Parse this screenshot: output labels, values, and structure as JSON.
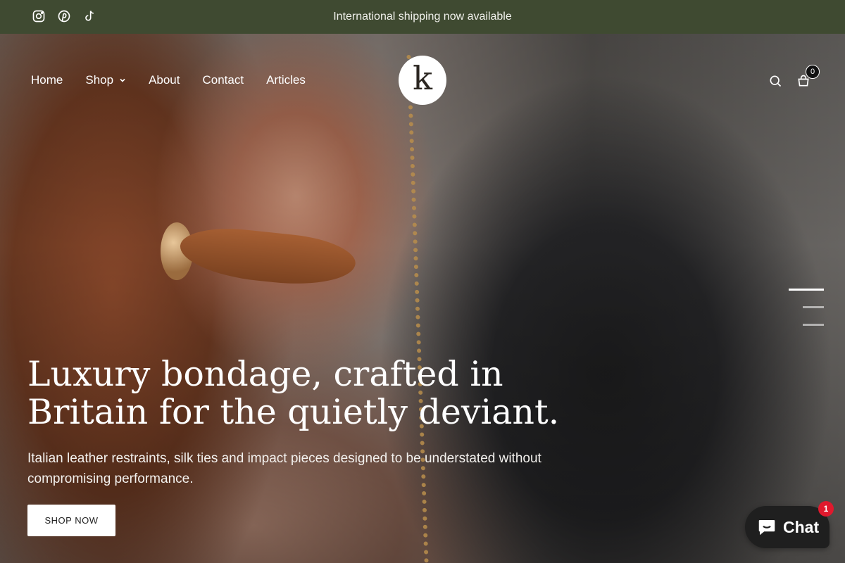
{
  "announcement": {
    "text": "International shipping now available"
  },
  "social": [
    {
      "icon": "instagram-icon"
    },
    {
      "icon": "pinterest-icon"
    },
    {
      "icon": "tiktok-icon"
    }
  ],
  "nav": {
    "items": [
      {
        "label": "Home"
      },
      {
        "label": "Shop",
        "has_dropdown": true
      },
      {
        "label": "About"
      },
      {
        "label": "Contact"
      },
      {
        "label": "Articles"
      }
    ]
  },
  "logo": {
    "letter": "k"
  },
  "header_actions": {
    "search_icon": "search-icon",
    "cart_icon": "cart-icon",
    "cart_count": "0"
  },
  "slider": {
    "total_slides": 3,
    "active_index": 0
  },
  "hero": {
    "headline": "Luxury bondage, crafted in Britain for the quietly deviant.",
    "subtext": "Italian leather restraints, silk ties and impact pieces designed to be understated without compromising performance.",
    "cta_label": "SHOP NOW"
  },
  "chat": {
    "label": "Chat",
    "badge_count": "1"
  },
  "colors": {
    "announcement_bg": "#3f4a31",
    "chat_bg": "#1f1f1f",
    "chat_badge": "#e0192d"
  }
}
